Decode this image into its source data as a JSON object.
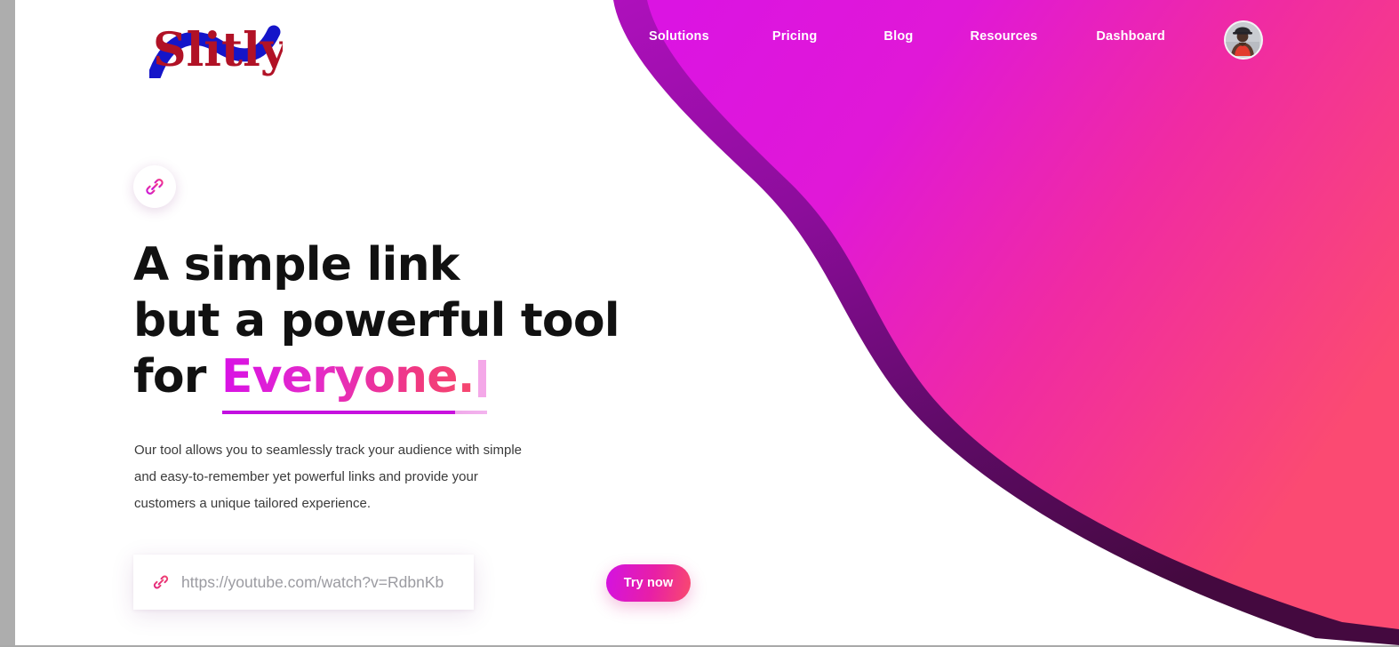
{
  "brand": {
    "name": "Slitly",
    "logo_text_color": "#B11226",
    "logo_ribbon_color": "#1515C9"
  },
  "theme": {
    "blob_magenta": "#E019DC",
    "blob_pink": "#FB4A72",
    "blob_pink_low": "#FB4089",
    "blob_border_top": "#A810B5",
    "blob_border_bottom": "#4D0B52",
    "accent_magenta": "#D312E2",
    "accent_pink": "#F94A6E",
    "caret_pink": "#F4A8E8",
    "scrollbar_gray": "#adadad"
  },
  "nav": {
    "items": [
      {
        "label": "Solutions",
        "name": "nav-link-solutions"
      },
      {
        "label": "Pricing",
        "name": "nav-link-pricing"
      },
      {
        "label": "Blog",
        "name": "nav-link-blog"
      },
      {
        "label": "Resources",
        "name": "nav-link-resources"
      },
      {
        "label": "Dashboard",
        "name": "nav-link-dashboard"
      }
    ],
    "avatar_alt": "user-avatar"
  },
  "hero": {
    "badge_icon": "link-chain-icon",
    "headline_line1": "A simple link",
    "headline_line2": "but a powerful tool",
    "headline_line3_prefix": "for ",
    "headline_highlight": "Everyone.",
    "subtext": "Our tool allows you to seamlessly track your audience with simple and easy-to-remember yet powerful links and provide your customers a unique tailored experience.",
    "form": {
      "input_icon": "link-chain-icon",
      "input_value": "",
      "input_placeholder": "https://youtube.com/watch?v=RdbnKb",
      "submit_label": "Try now"
    }
  }
}
